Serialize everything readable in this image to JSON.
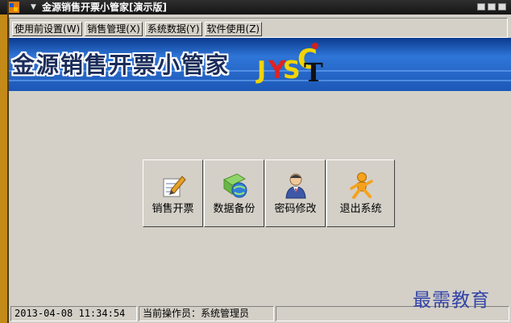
{
  "window": {
    "title": "金源销售开票小管家[演示版]"
  },
  "menu": {
    "items": [
      {
        "label": "使用前设置(W)"
      },
      {
        "label": "销售管理(X)"
      },
      {
        "label": "系统数据(Y)"
      },
      {
        "label": "软件使用(Z)"
      }
    ]
  },
  "banner": {
    "title": "金源销售开票小管家",
    "logo_letters": {
      "j": "J",
      "y": "Y",
      "s": "S",
      "c": "C",
      "t": "T"
    }
  },
  "buttons": [
    {
      "label": "销售开票",
      "icon": "invoice-pen-icon"
    },
    {
      "label": "数据备份",
      "icon": "backup-globe-icon"
    },
    {
      "label": "密码修改",
      "icon": "user-key-icon"
    },
    {
      "label": "退出系统",
      "icon": "exit-person-icon"
    }
  ],
  "status": {
    "datetime": "2013-04-08 11:34:54",
    "operator_label": "当前操作员：系统管理员",
    "extra": ""
  },
  "watermark": "最需教育",
  "colors": {
    "titlebar": "#1e1e1e",
    "banner": "#2f76d8",
    "window_border": "#c38a18",
    "face": "#d4d0c8"
  }
}
